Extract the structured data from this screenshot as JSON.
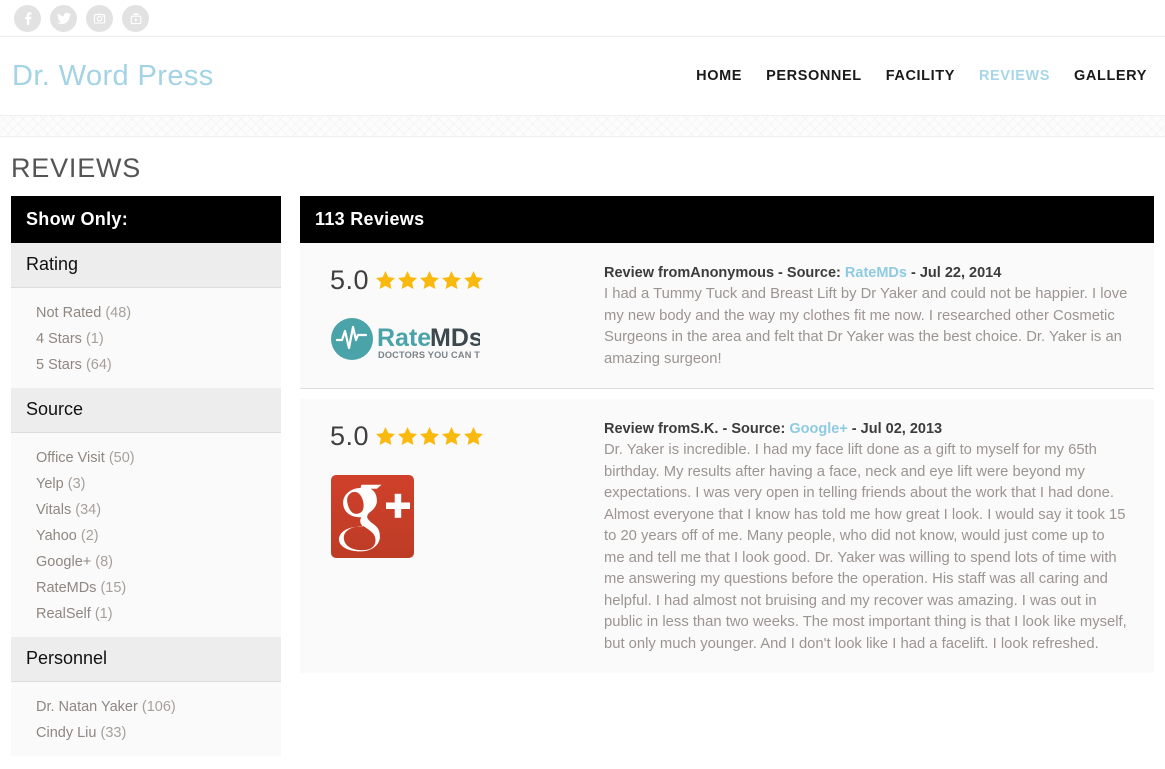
{
  "social": {
    "items": [
      {
        "name": "facebook-icon",
        "label": "Facebook"
      },
      {
        "name": "twitter-icon",
        "label": "Twitter"
      },
      {
        "name": "instagram-icon",
        "label": "Instagram"
      },
      {
        "name": "youtube-icon",
        "label": "YouTube"
      }
    ]
  },
  "header": {
    "brand": "Dr. Word Press",
    "nav": [
      {
        "label": "HOME",
        "active": false
      },
      {
        "label": "PERSONNEL",
        "active": false
      },
      {
        "label": "FACILITY",
        "active": false
      },
      {
        "label": "REVIEWS",
        "active": true
      },
      {
        "label": "GALLERY",
        "active": false
      }
    ]
  },
  "page": {
    "title": "REVIEWS"
  },
  "sidebar": {
    "header": "Show Only:",
    "groups": [
      {
        "title": "Rating",
        "items": [
          {
            "label": "Not Rated",
            "count": "(48)"
          },
          {
            "label": "4 Stars",
            "count": "(1)"
          },
          {
            "label": "5 Stars",
            "count": "(64)"
          }
        ]
      },
      {
        "title": "Source",
        "items": [
          {
            "label": "Office Visit",
            "count": "(50)"
          },
          {
            "label": "Yelp",
            "count": "(3)"
          },
          {
            "label": "Vitals",
            "count": "(34)"
          },
          {
            "label": "Yahoo",
            "count": "(2)"
          },
          {
            "label": "Google+",
            "count": "(8)"
          },
          {
            "label": "RateMDs",
            "count": "(15)"
          },
          {
            "label": "RealSelf",
            "count": "(1)"
          }
        ]
      },
      {
        "title": "Personnel",
        "items": [
          {
            "label": "Dr. Natan Yaker",
            "count": "(106)"
          },
          {
            "label": "Cindy Liu",
            "count": "(33)"
          }
        ]
      }
    ]
  },
  "reviews_panel": {
    "header": "113 Reviews",
    "reviews": [
      {
        "rating": "5.0",
        "stars": 5,
        "logo": "ratemds-logo",
        "logo_text": "RateMDs",
        "logo_tagline": "DOCTORS YOU CAN TRUST",
        "meta_prefix": "Review from",
        "author": "Anonymous",
        "meta_source_label": " - Source: ",
        "source": "RateMDs",
        "meta_date_sep": " - ",
        "date": "Jul 22, 2014",
        "text": "I had a Tummy Tuck and Breast Lift by Dr Yaker and could not be happier. I love my new body and the way my clothes fit me now. I researched other Cosmetic Surgeons in the area and felt that Dr Yaker was the best choice. Dr. Yaker is an amazing surgeon!"
      },
      {
        "rating": "5.0",
        "stars": 5,
        "logo": "google-plus-logo",
        "logo_text": "g+",
        "logo_tagline": "",
        "meta_prefix": "Review from",
        "author": "S.K.",
        "meta_source_label": " - Source: ",
        "source": "Google+",
        "meta_date_sep": " - ",
        "date": "Jul 02, 2013",
        "text": "Dr. Yaker is incredible. I had my face lift done as a gift to myself for my 65th birthday. My results after having a face, neck and eye lift were beyond my expectations. I was very open in telling friends about the work that I had done. Almost everyone that I know has told me how great I look. I would say it took 15 to 20 years off of me. Many people, who did not know, would just come up to me and tell me that I look good. Dr. Yaker was willing to spend lots of time with me answering my questions before the operation. His staff was all caring and helpful. I had almost not bruising and my recover was amazing. I was out in public in less than two weeks. The most important thing is that I look like myself, but only much younger. And I don't look like I had a facelift. I look refreshed."
      }
    ]
  },
  "colors": {
    "brand_blue": "#a3d3e4",
    "link_blue": "#8ecbe2",
    "star_gold": "#f9b90f",
    "panel_black": "#000000",
    "ratemds_teal": "#4aa3a8",
    "googleplus_red": "#c9452c"
  }
}
